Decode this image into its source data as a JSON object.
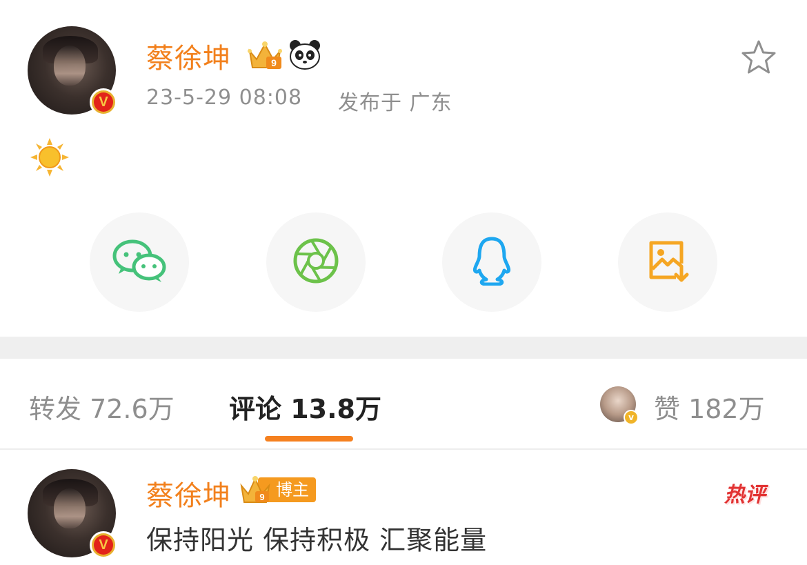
{
  "post": {
    "author_name": "蔡徐坤",
    "verified_badge": "V",
    "timestamp": "23-5-29 08:08",
    "location": "发布于 广东",
    "content_emoji": "sun-emoji",
    "crown_level": "9",
    "extra_emoji": "panda-emoji"
  },
  "share": {
    "items": [
      {
        "name": "wechat",
        "icon": "wechat-icon",
        "color": "#45c27a"
      },
      {
        "name": "moments",
        "icon": "aperture-icon",
        "color": "#6cc24a"
      },
      {
        "name": "qq",
        "icon": "qq-penguin-icon",
        "color": "#1ea7f0"
      },
      {
        "name": "save-image",
        "icon": "save-image-icon",
        "color": "#f5a623"
      }
    ]
  },
  "tabs": {
    "repost": "转发 72.6万",
    "comments": "评论 13.8万",
    "likes": "赞 182万",
    "active": "comments"
  },
  "comment": {
    "author_name": "蔡徐坤",
    "verified_badge": "V",
    "crown_level": "9",
    "tag": "博主",
    "hot_label": "热评",
    "text": "保持阳光 保持积极 汇聚能量"
  },
  "colors": {
    "accent": "#f5801f",
    "name": "#f2801c",
    "meta": "#8f8f8f"
  }
}
